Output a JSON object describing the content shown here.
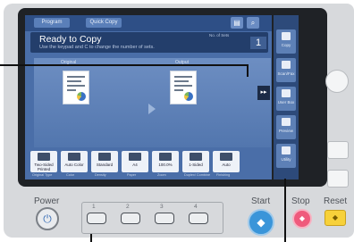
{
  "screen": {
    "top_tabs": [
      "Program",
      "Quick Copy"
    ],
    "title": "Ready to Copy",
    "hint": "Use the keypad and C to change the number of sets.",
    "sets_label": "No. of Sets",
    "count": "1",
    "original_label": "Original",
    "output_label": "Output",
    "functions": [
      {
        "label": "Two-Sided Printed",
        "caption": "Original Type"
      },
      {
        "label": "Auto Color",
        "caption": "Color"
      },
      {
        "label": "Standard",
        "caption": "Density"
      },
      {
        "label": "A4",
        "caption": "Paper"
      },
      {
        "label": "100.0%",
        "caption": "Zoom"
      },
      {
        "label": "1-Sided",
        "caption": "Duplex/ Combine"
      },
      {
        "label": "Auto",
        "caption": "Finishing"
      }
    ]
  },
  "sidebar": {
    "items": [
      {
        "label": "Copy",
        "icon": "copy-icon"
      },
      {
        "label": "Scan/Fax",
        "icon": "scan-fax-icon"
      },
      {
        "label": "User Box",
        "icon": "user-box-icon"
      },
      {
        "label": "Preview",
        "icon": "preview-icon"
      },
      {
        "label": "Utility",
        "icon": "utility-icon"
      }
    ]
  },
  "hardware": {
    "power_label": "Power",
    "register_keys": [
      "1",
      "2",
      "3",
      "4"
    ],
    "start_label": "Start",
    "stop_label": "Stop",
    "reset_label": "Reset"
  },
  "colors": {
    "screen_bg": "#4a6ea8",
    "start": "#3a95d9",
    "stop": "#ef5a7c",
    "reset": "#f7d13a"
  }
}
